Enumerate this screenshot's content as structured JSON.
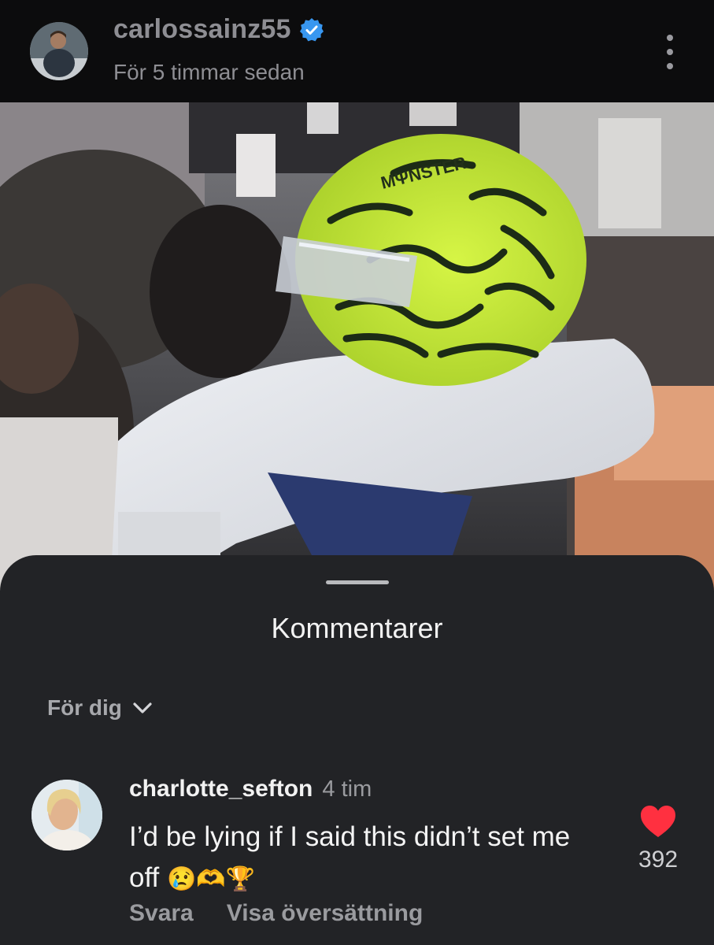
{
  "post": {
    "username": "carlossainz55",
    "timestamp": "För 5 timmar sedan"
  },
  "video": {
    "helmet_logo_text": "MΨNSTER"
  },
  "comments_sheet": {
    "title": "Kommentarer",
    "filter_label": "För dig",
    "comments": [
      {
        "username": "charlotte_sefton",
        "time": "4 tim",
        "text": "I’d be lying if I said this didn’t set me off",
        "emoji": "😢🫶🏆",
        "reply_label": "Svara",
        "translate_label": "Visa översättning",
        "like_count": "392"
      }
    ]
  },
  "colors": {
    "header_bg": "#0c0c0d",
    "sheet_bg": "#222326",
    "verified_blue": "#3897f0",
    "like_red": "#ff3040",
    "helmet_yellow": "#c9ef32"
  },
  "icons": [
    "verified-badge-icon",
    "more-options-icon",
    "chevron-down-icon",
    "heart-icon"
  ]
}
